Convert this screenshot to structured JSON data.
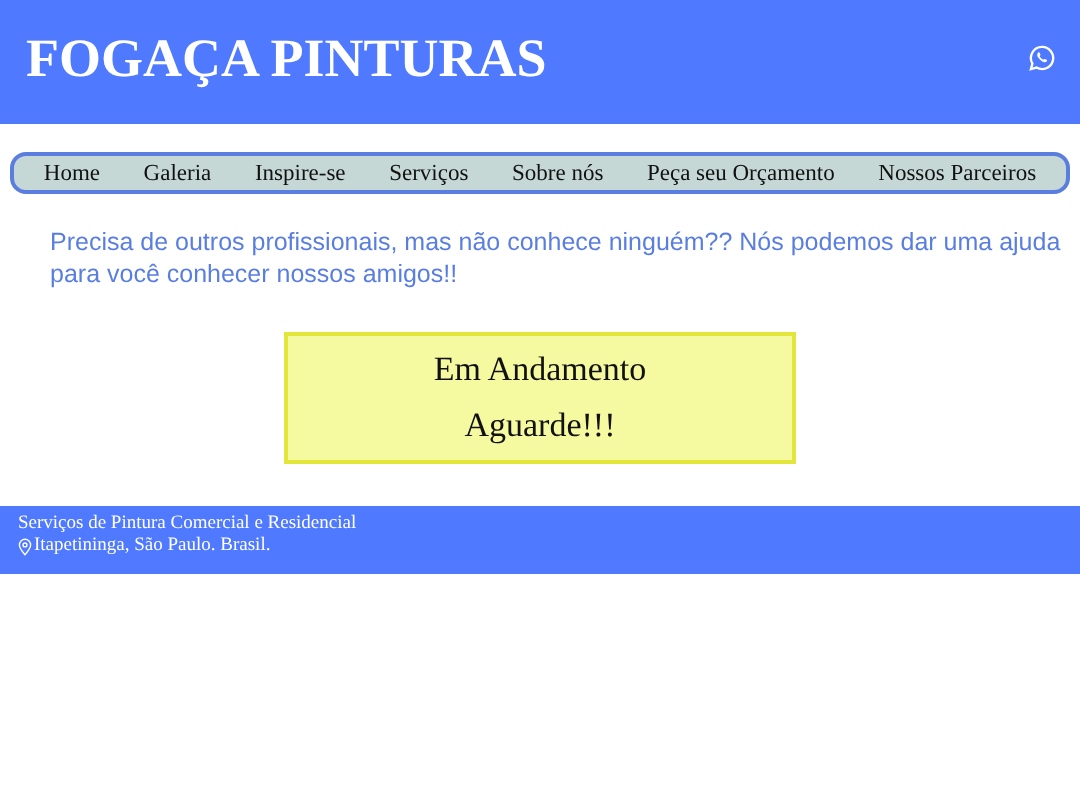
{
  "header": {
    "title": "FOGAÇA PINTURAS"
  },
  "nav": [
    "Home",
    "Galeria",
    "Inspire-se",
    "Serviços",
    "Sobre nós",
    "Peça seu Orçamento",
    "Nossos Parceiros"
  ],
  "intro": "Precisa de outros profissionais, mas não conhece ninguém?? Nós podemos dar uma ajuda para você conhecer nossos amigos!!",
  "notice": [
    "Em Andamento",
    "Aguarde!!!"
  ],
  "footer": {
    "tagline": "Serviços de Pintura Comercial e Residencial",
    "location": "Itapetininga, São Paulo. Brasil."
  }
}
